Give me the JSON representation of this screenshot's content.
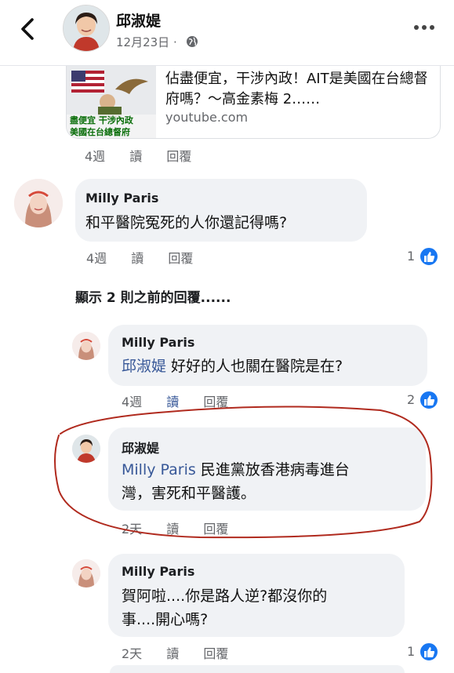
{
  "header": {
    "poster_name": "邱淑媞",
    "date": "12月23日",
    "date_sep": "·"
  },
  "link_preview": {
    "title": "佔盡便宜，干涉內政！AIT是美國在台總督府嗎？～高金素梅 2……",
    "source": "youtube.com",
    "thumb_text_1": "盡便宜  干涉內政",
    "thumb_text_2": "美國在台總督府"
  },
  "labels": {
    "read": "讀",
    "reply": "回覆"
  },
  "top_actions": {
    "time": "4週"
  },
  "comment_1": {
    "author": "Milly Paris",
    "text": "和平醫院冤死的人你還記得嗎?",
    "time": "4週",
    "reactions": "1"
  },
  "show_previous": "顯示 2 則之前的回覆......",
  "replies": [
    {
      "author": "Milly Paris",
      "mention": "邱淑媞",
      "text": " 好好的人也關在醫院是在?",
      "time": "4週",
      "reactions": "2"
    },
    {
      "author": "邱淑媞",
      "mention": "Milly Paris",
      "line1": " 民進黨放香港病毒進台",
      "line2": "灣，害死和平醫護。",
      "time": "2天"
    },
    {
      "author": "Milly Paris",
      "line1": "賀阿啦....你是路人逆?都沒你的",
      "line2": "事....開心嗎?",
      "time": "2天",
      "reactions": "1"
    }
  ],
  "colors": {
    "like_blue": "#1877f2",
    "mention_blue": "#385898",
    "bubble_gray": "#f0f2f5",
    "annotation_red": "#b02a1e"
  }
}
